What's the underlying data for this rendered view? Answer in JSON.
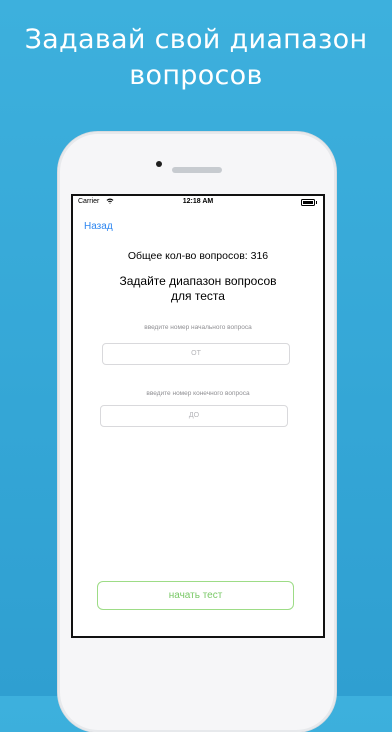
{
  "promo": {
    "headline_line1": "Задавай свой диапазон",
    "headline_line2": "вопросов"
  },
  "status_bar": {
    "carrier": "Carrier",
    "time": "12:18 AM"
  },
  "nav": {
    "back_label": "Назад"
  },
  "screen": {
    "total_text": "Общее кол-во вопросов: 316",
    "ask_line1": "Задайте диапазон вопросов",
    "ask_line2": "для теста",
    "start_hint": "введите номер начального вопроса",
    "start_placeholder": "ОТ",
    "end_hint": "введите номер конечного вопроса",
    "end_placeholder": "ДО",
    "start_button": "начать тест"
  },
  "colors": {
    "background": "#34a6d6",
    "link": "#2d86f0",
    "accent_green": "#79c866"
  }
}
